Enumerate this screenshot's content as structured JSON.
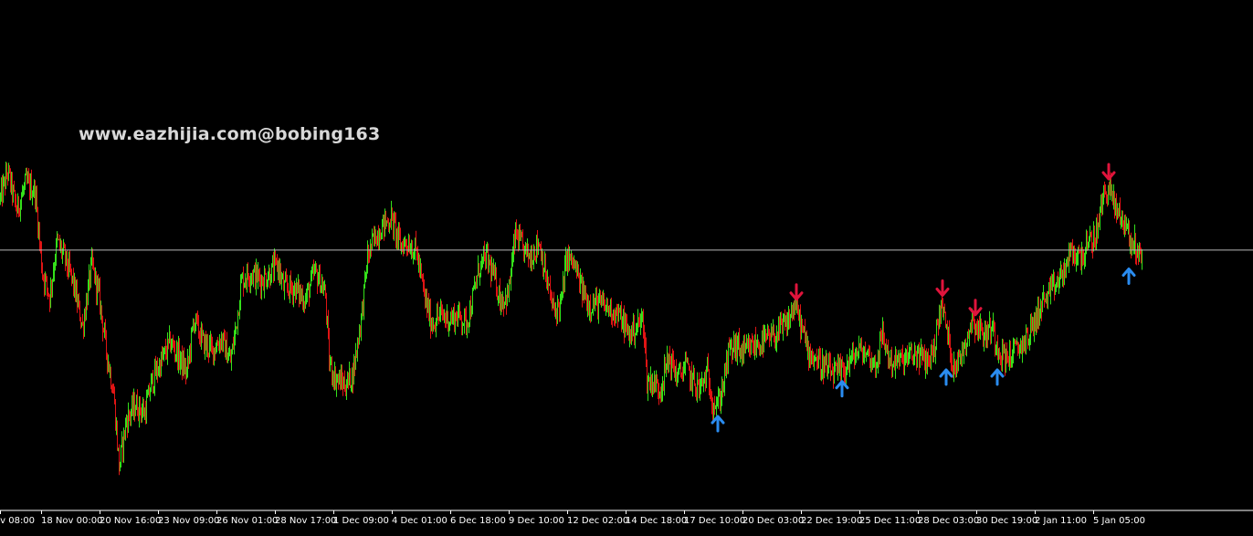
{
  "watermark": "www.eazhijia.com@bobing163",
  "colors": {
    "background": "#000000",
    "bull": "#34e01a",
    "bear": "#e01414",
    "buy_arrow": "#2a8cf0",
    "sell_arrow": "#e0143c",
    "reference_line": "#b8b8b8",
    "axis": "#ffffff"
  },
  "chart_data": {
    "type": "candlestick",
    "grid": false,
    "x_ticks": [
      "ov 08:00",
      "18 Nov 00:00",
      "20 Nov 16:00",
      "23 Nov 09:00",
      "26 Nov 01:00",
      "28 Nov 17:00",
      "1 Dec 09:00",
      "4 Dec 01:00",
      "6 Dec 18:00",
      "9 Dec 10:00",
      "12 Dec 02:00",
      "14 Dec 18:00",
      "17 Dec 10:00",
      "20 Dec 03:00",
      "22 Dec 19:00",
      "25 Dec 11:00",
      "28 Dec 03:00",
      "30 Dec 19:00",
      "2 Jan 11:00",
      "5 Jan 05:00"
    ],
    "ylim": [
      0,
      100
    ],
    "price_path": [
      [
        0,
        77
      ],
      [
        8,
        84
      ],
      [
        18,
        74
      ],
      [
        28,
        81
      ],
      [
        38,
        79
      ],
      [
        46,
        58
      ],
      [
        54,
        52
      ],
      [
        62,
        66
      ],
      [
        70,
        62
      ],
      [
        80,
        55
      ],
      [
        90,
        44
      ],
      [
        100,
        60
      ],
      [
        108,
        52
      ],
      [
        116,
        38
      ],
      [
        124,
        27
      ],
      [
        130,
        8
      ],
      [
        138,
        20
      ],
      [
        148,
        24
      ],
      [
        158,
        22
      ],
      [
        166,
        30
      ],
      [
        176,
        35
      ],
      [
        186,
        40
      ],
      [
        194,
        37
      ],
      [
        204,
        32
      ],
      [
        212,
        46
      ],
      [
        222,
        40
      ],
      [
        232,
        38
      ],
      [
        242,
        41
      ],
      [
        252,
        35
      ],
      [
        258,
        44
      ],
      [
        264,
        56
      ],
      [
        274,
        58
      ],
      [
        286,
        56
      ],
      [
        296,
        58
      ],
      [
        304,
        60
      ],
      [
        310,
        54
      ],
      [
        322,
        54
      ],
      [
        334,
        51
      ],
      [
        344,
        58
      ],
      [
        350,
        56
      ],
      [
        356,
        52
      ],
      [
        360,
        35
      ],
      [
        366,
        31
      ],
      [
        372,
        30
      ],
      [
        378,
        29
      ],
      [
        386,
        32
      ],
      [
        396,
        48
      ],
      [
        402,
        62
      ],
      [
        410,
        67
      ],
      [
        418,
        70
      ],
      [
        428,
        72
      ],
      [
        438,
        65
      ],
      [
        446,
        66
      ],
      [
        456,
        63
      ],
      [
        464,
        52
      ],
      [
        472,
        45
      ],
      [
        482,
        47
      ],
      [
        492,
        46
      ],
      [
        502,
        47
      ],
      [
        510,
        45
      ],
      [
        516,
        50
      ],
      [
        524,
        59
      ],
      [
        532,
        62
      ],
      [
        540,
        57
      ],
      [
        548,
        51
      ],
      [
        556,
        52
      ],
      [
        564,
        68
      ],
      [
        572,
        64
      ],
      [
        580,
        62
      ],
      [
        590,
        66
      ],
      [
        598,
        56
      ],
      [
        606,
        48
      ],
      [
        614,
        50
      ],
      [
        620,
        62
      ],
      [
        628,
        60
      ],
      [
        636,
        54
      ],
      [
        644,
        50
      ],
      [
        654,
        50
      ],
      [
        664,
        49
      ],
      [
        672,
        48
      ],
      [
        680,
        46
      ],
      [
        688,
        42
      ],
      [
        696,
        44
      ],
      [
        704,
        46
      ],
      [
        708,
        30
      ],
      [
        714,
        30
      ],
      [
        722,
        28
      ],
      [
        732,
        36
      ],
      [
        742,
        31
      ],
      [
        750,
        34
      ],
      [
        758,
        30
      ],
      [
        766,
        28
      ],
      [
        774,
        32
      ],
      [
        780,
        25
      ],
      [
        786,
        24
      ],
      [
        792,
        30
      ],
      [
        798,
        38
      ],
      [
        806,
        39
      ],
      [
        814,
        37
      ],
      [
        824,
        39
      ],
      [
        834,
        40
      ],
      [
        844,
        41
      ],
      [
        854,
        43
      ],
      [
        862,
        45
      ],
      [
        870,
        50
      ],
      [
        876,
        45
      ],
      [
        884,
        38
      ],
      [
        892,
        36
      ],
      [
        900,
        34
      ],
      [
        910,
        32
      ],
      [
        920,
        32
      ],
      [
        930,
        35
      ],
      [
        940,
        38
      ],
      [
        950,
        37
      ],
      [
        958,
        34
      ],
      [
        966,
        42
      ],
      [
        974,
        35
      ],
      [
        984,
        35
      ],
      [
        994,
        36
      ],
      [
        1004,
        37
      ],
      [
        1014,
        35
      ],
      [
        1022,
        38
      ],
      [
        1030,
        50
      ],
      [
        1036,
        44
      ],
      [
        1042,
        35
      ],
      [
        1050,
        35
      ],
      [
        1056,
        40
      ],
      [
        1064,
        46
      ],
      [
        1070,
        44
      ],
      [
        1078,
        42
      ],
      [
        1086,
        44
      ],
      [
        1092,
        39
      ],
      [
        1100,
        36
      ],
      [
        1108,
        37
      ],
      [
        1116,
        39
      ],
      [
        1124,
        41
      ],
      [
        1132,
        45
      ],
      [
        1140,
        50
      ],
      [
        1148,
        52
      ],
      [
        1156,
        55
      ],
      [
        1164,
        58
      ],
      [
        1172,
        63
      ],
      [
        1182,
        62
      ],
      [
        1192,
        65
      ],
      [
        1200,
        68
      ],
      [
        1208,
        78
      ],
      [
        1214,
        80
      ],
      [
        1220,
        75
      ],
      [
        1228,
        72
      ],
      [
        1234,
        70
      ],
      [
        1238,
        64
      ],
      [
        1242,
        66
      ],
      [
        1246,
        62
      ],
      [
        1250,
        64
      ]
    ],
    "reference_line_level": 63.8,
    "buy_signals": [
      {
        "x": 786,
        "level": 24
      },
      {
        "x": 922,
        "level": 33
      },
      {
        "x": 1036,
        "level": 36
      },
      {
        "x": 1092,
        "level": 36
      },
      {
        "x": 1236,
        "level": 62
      }
    ],
    "sell_signals": [
      {
        "x": 872,
        "level": 49
      },
      {
        "x": 1032,
        "level": 50
      },
      {
        "x": 1068,
        "level": 45
      },
      {
        "x": 1214,
        "level": 80
      }
    ]
  }
}
